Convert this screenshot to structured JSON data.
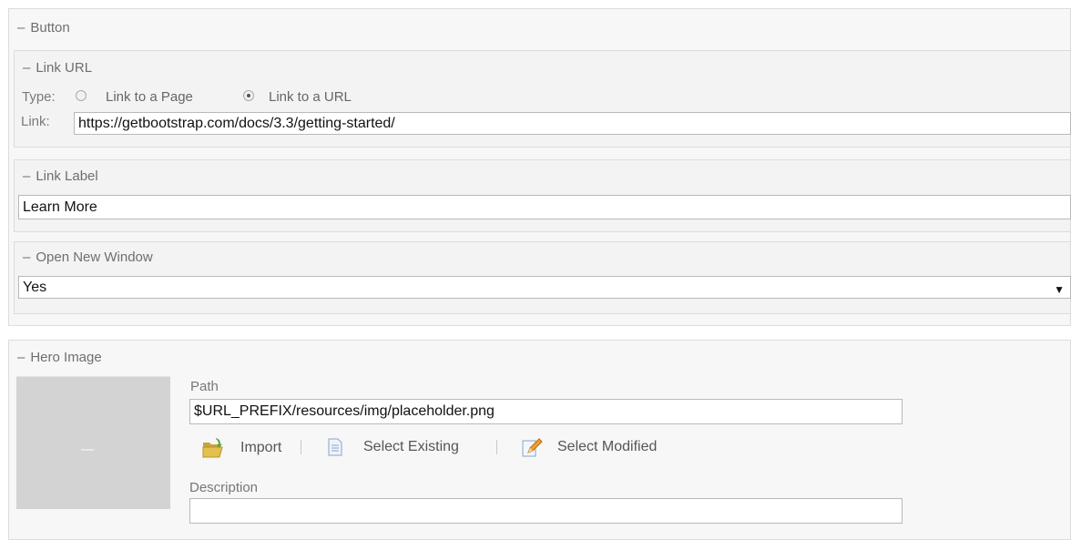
{
  "button_section": {
    "title": "Button",
    "link_url": {
      "title": "Link URL",
      "type_label": "Type:",
      "options": [
        {
          "label": "Link to a Page",
          "checked": false
        },
        {
          "label": "Link to a URL",
          "checked": true
        }
      ],
      "link_label": "Link:",
      "link_value": "https://getbootstrap.com/docs/3.3/getting-started/"
    },
    "link_label_group": {
      "title": "Link Label",
      "value": "Learn More"
    },
    "open_new_window": {
      "title": "Open New Window",
      "selected": "Yes"
    }
  },
  "hero_image": {
    "title": "Hero Image",
    "path_label": "Path",
    "path_value": "$URL_PREFIX/resources/img/placeholder.png",
    "actions": {
      "import": "Import",
      "select_existing": "Select Existing",
      "select_modified": "Select Modified"
    },
    "description_label": "Description",
    "description_value": ""
  },
  "icons": {
    "import": "folder-icon",
    "select_existing": "document-icon",
    "select_modified": "edit-icon",
    "dropdown": "caret-down-icon"
  }
}
